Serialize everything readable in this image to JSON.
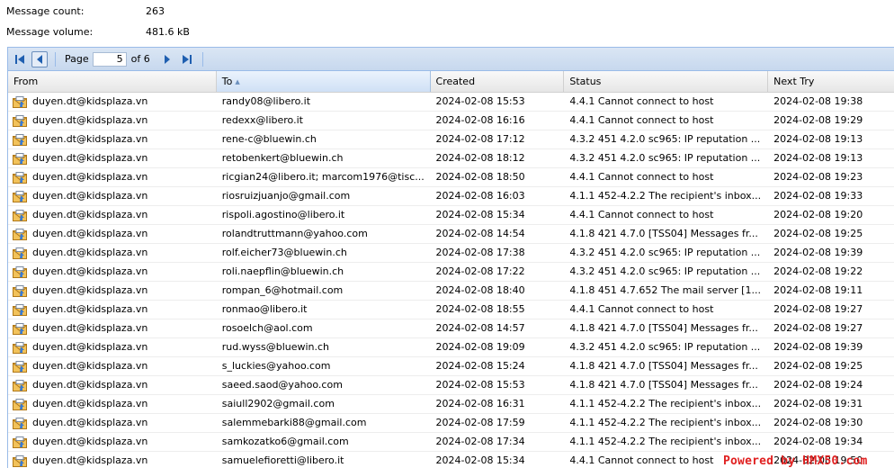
{
  "stats": {
    "count_label": "Message count:",
    "count_value": "263",
    "volume_label": "Message volume:",
    "volume_value": "481.6 kB"
  },
  "pager": {
    "page_label": "Page",
    "page_value": "5",
    "of_label": "of 6"
  },
  "columns": [
    "From",
    "To",
    "Created",
    "Status",
    "Next Try"
  ],
  "sorted_column": "To",
  "rows": [
    [
      "duyen.dt@kidsplaza.vn",
      "randy08@libero.it",
      "2024-02-08 15:53",
      "4.4.1 Cannot connect to host",
      "2024-02-08 19:38"
    ],
    [
      "duyen.dt@kidsplaza.vn",
      "redexx@libero.it",
      "2024-02-08 16:16",
      "4.4.1 Cannot connect to host",
      "2024-02-08 19:29"
    ],
    [
      "duyen.dt@kidsplaza.vn",
      "rene-c@bluewin.ch",
      "2024-02-08 17:12",
      "4.3.2 451 4.2.0 sc965: IP reputation ...",
      "2024-02-08 19:13"
    ],
    [
      "duyen.dt@kidsplaza.vn",
      "retobenkert@bluewin.ch",
      "2024-02-08 18:12",
      "4.3.2 451 4.2.0 sc965: IP reputation ...",
      "2024-02-08 19:13"
    ],
    [
      "duyen.dt@kidsplaza.vn",
      "ricgian24@libero.it; marcom1976@tisc...",
      "2024-02-08 18:50",
      "4.4.1 Cannot connect to host",
      "2024-02-08 19:23"
    ],
    [
      "duyen.dt@kidsplaza.vn",
      "riosruizjuanjo@gmail.com",
      "2024-02-08 16:03",
      "4.1.1 452-4.2.2 The recipient's inbox...",
      "2024-02-08 19:33"
    ],
    [
      "duyen.dt@kidsplaza.vn",
      "rispoli.agostino@libero.it",
      "2024-02-08 15:34",
      "4.4.1 Cannot connect to host",
      "2024-02-08 19:20"
    ],
    [
      "duyen.dt@kidsplaza.vn",
      "rolandtruttmann@yahoo.com",
      "2024-02-08 14:54",
      "4.1.8 421 4.7.0 [TSS04] Messages fr...",
      "2024-02-08 19:25"
    ],
    [
      "duyen.dt@kidsplaza.vn",
      "rolf.eicher73@bluewin.ch",
      "2024-02-08 17:38",
      "4.3.2 451 4.2.0 sc965: IP reputation ...",
      "2024-02-08 19:39"
    ],
    [
      "duyen.dt@kidsplaza.vn",
      "roli.naepflin@bluewin.ch",
      "2024-02-08 17:22",
      "4.3.2 451 4.2.0 sc965: IP reputation ...",
      "2024-02-08 19:22"
    ],
    [
      "duyen.dt@kidsplaza.vn",
      "rompan_6@hotmail.com",
      "2024-02-08 18:40",
      "4.1.8 451 4.7.652 The mail server [1...",
      "2024-02-08 19:11"
    ],
    [
      "duyen.dt@kidsplaza.vn",
      "ronmao@libero.it",
      "2024-02-08 18:55",
      "4.4.1 Cannot connect to host",
      "2024-02-08 19:27"
    ],
    [
      "duyen.dt@kidsplaza.vn",
      "rosoelch@aol.com",
      "2024-02-08 14:57",
      "4.1.8 421 4.7.0 [TSS04] Messages fr...",
      "2024-02-08 19:27"
    ],
    [
      "duyen.dt@kidsplaza.vn",
      "rud.wyss@bluewin.ch",
      "2024-02-08 19:09",
      "4.3.2 451 4.2.0 sc965: IP reputation ...",
      "2024-02-08 19:39"
    ],
    [
      "duyen.dt@kidsplaza.vn",
      "s_luckies@yahoo.com",
      "2024-02-08 15:24",
      "4.1.8 421 4.7.0 [TSS04] Messages fr...",
      "2024-02-08 19:25"
    ],
    [
      "duyen.dt@kidsplaza.vn",
      "saeed.saod@yahoo.com",
      "2024-02-08 15:53",
      "4.1.8 421 4.7.0 [TSS04] Messages fr...",
      "2024-02-08 19:24"
    ],
    [
      "duyen.dt@kidsplaza.vn",
      "saiull2902@gmail.com",
      "2024-02-08 16:31",
      "4.1.1 452-4.2.2 The recipient's inbox...",
      "2024-02-08 19:31"
    ],
    [
      "duyen.dt@kidsplaza.vn",
      "salemmebarki88@gmail.com",
      "2024-02-08 17:59",
      "4.1.1 452-4.2.2 The recipient's inbox...",
      "2024-02-08 19:30"
    ],
    [
      "duyen.dt@kidsplaza.vn",
      "samkozatko6@gmail.com",
      "2024-02-08 17:34",
      "4.1.1 452-4.2.2 The recipient's inbox...",
      "2024-02-08 19:34"
    ],
    [
      "duyen.dt@kidsplaza.vn",
      "samuelefioretti@libero.it",
      "2024-02-08 15:34",
      "4.4.1 Cannot connect to host",
      "2024-02-08 19:50"
    ]
  ],
  "watermark": "Powered by HMX50.com",
  "colors": {
    "header_border": "#99bbe8",
    "accent": "#1f5fb0",
    "watermark": "#e02020"
  },
  "icons": [
    "first-page-icon",
    "prev-page-icon",
    "next-page-icon",
    "last-page-icon",
    "envelope-icon",
    "sort-asc-icon"
  ]
}
